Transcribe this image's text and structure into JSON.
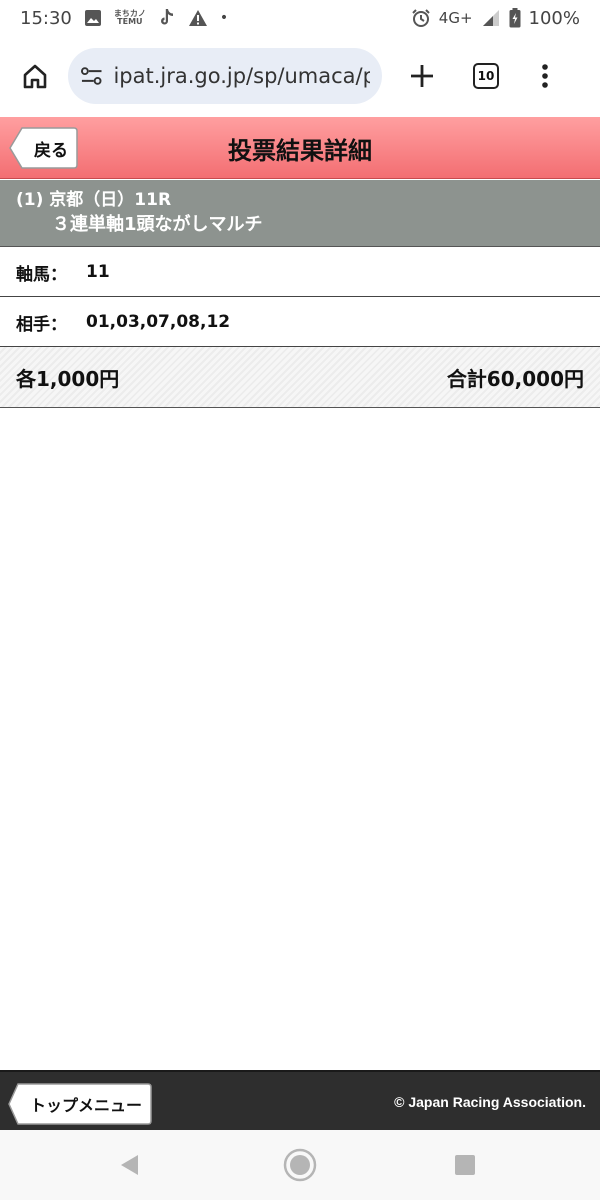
{
  "status_bar": {
    "time": "15:30",
    "temu_top": "まちカノ",
    "temu_bottom": "TEMU",
    "dot": "•",
    "network": "4G+",
    "battery": "100%",
    "icons": [
      "image-icon",
      "temu-icon",
      "tiktok-icon",
      "warning-icon",
      "alarm-icon",
      "signal-icon",
      "battery-icon"
    ]
  },
  "browser": {
    "url": "ipat.jra.go.jp/sp/umaca/p",
    "tab_count": "10",
    "icons": [
      "home-icon",
      "site-settings-icon",
      "new-tab-icon",
      "tab-switcher-icon",
      "more-menu-icon"
    ]
  },
  "header": {
    "back_label": "戻る",
    "title": "投票結果詳細",
    "background_color": "#f47a7d"
  },
  "race": {
    "line1": "(1) 京都（日）11R",
    "line2": "３連単軸1頭ながしマルチ"
  },
  "details": [
    {
      "label": "軸馬：",
      "value": "11"
    },
    {
      "label": "相手：",
      "value": "01,03,07,08,12"
    }
  ],
  "amounts": {
    "each": "各1,000円",
    "total": "合計60,000円"
  },
  "footer": {
    "top_menu_label": "トップメニュー",
    "copyright": "© Japan Racing Association."
  },
  "nav": {
    "icons": [
      "back-triangle-icon",
      "home-circle-icon",
      "recents-square-icon"
    ]
  }
}
